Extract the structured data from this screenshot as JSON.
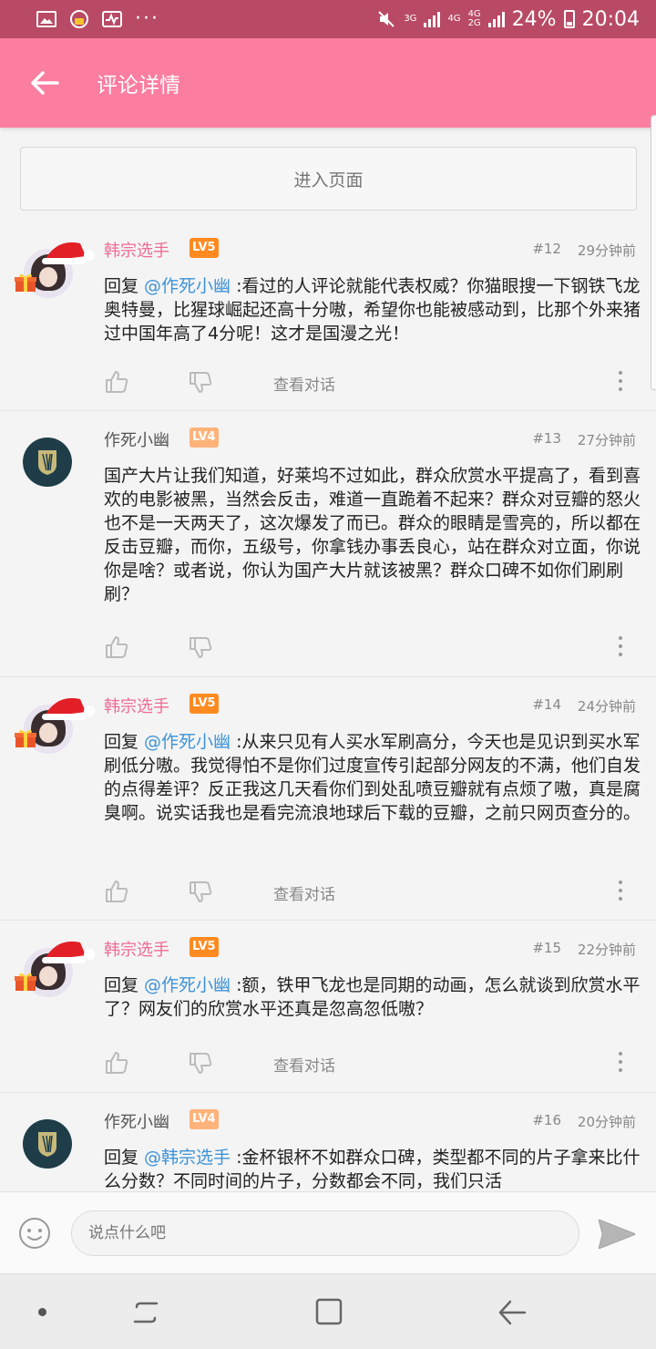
{
  "status_bar": {
    "net_3g": "3G",
    "net_4g": "4G",
    "net_4g2": "4G",
    "net_2g": "2G",
    "battery": "24%",
    "time": "20:04"
  },
  "app_bar": {
    "title": "评论详情"
  },
  "enter_page_label": "进入页面",
  "comments": [
    {
      "name": "韩宗选手",
      "level": "LV5",
      "floor": "#12",
      "time": "29分钟前",
      "reply_prefix": "回复 ",
      "mention": "@作死小幽",
      "text": " :看过的人评论就能代表权威？你猫眼搜一下钢铁飞龙奥特曼，比猩球崛起还高十分嗷，希望你也能被感动到，比那个外来猪过中国年高了4分呢！这才是国漫之光！",
      "talk_label": "查看对话"
    },
    {
      "name": "作死小幽",
      "level": "LV4",
      "floor": "#13",
      "time": "27分钟前",
      "text": "国产大片让我们知道，好莱坞不过如此，群众欣赏水平提高了，看到喜欢的电影被黑，当然会反击，难道一直跪着不起来？群众对豆瓣的怒火也不是一天两天了，这次爆发了而已。群众的眼睛是雪亮的，所以都在反击豆瓣，而你，五级号，你拿钱办事丢良心，站在群众对立面，你说你是啥？或者说，你认为国产大片就该被黑？群众口碑不如你们刷刷刷？"
    },
    {
      "name": "韩宗选手",
      "level": "LV5",
      "floor": "#14",
      "time": "24分钟前",
      "reply_prefix": "回复 ",
      "mention": "@作死小幽",
      "text": " :从来只见有人买水军刷高分，今天也是见识到买水军刷低分嗷。我觉得怕不是你们过度宣传引起部分网友的不满，他们自发的点得差评？反正我这几天看你们到处乱喷豆瓣就有点烦了嗷，真是腐臭啊。说实话我也是看完流浪地球后下载的豆瓣，之前只网页查分的。",
      "talk_label": "查看对话"
    },
    {
      "name": "韩宗选手",
      "level": "LV5",
      "floor": "#15",
      "time": "22分钟前",
      "reply_prefix": "回复 ",
      "mention": "@作死小幽",
      "text": " :额，铁甲飞龙也是同期的动画，怎么就谈到欣赏水平了？网友们的欣赏水平还真是忽高忽低嗷？",
      "talk_label": "查看对话"
    },
    {
      "name": "作死小幽",
      "level": "LV4",
      "floor": "#16",
      "time": "20分钟前",
      "reply_prefix": "回复 ",
      "mention": "@韩宗选手",
      "text": " :金杯银杯不如群众口碑，类型都不同的片子拿来比什么分数？不同时间的片子，分数都会不同，我们只活"
    }
  ],
  "input": {
    "placeholder": "说点什么吧"
  }
}
